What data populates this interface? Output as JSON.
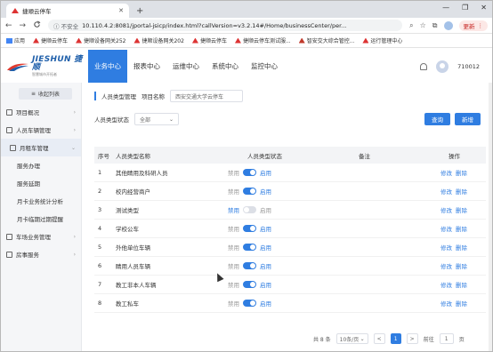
{
  "browser": {
    "tab_title": "捷顺云停车",
    "new_tab": "+",
    "window_controls": {
      "minimize": "—",
      "restore": "❐",
      "close": "✕"
    },
    "nav": {
      "back": "←",
      "forward": "→",
      "reload": "C"
    },
    "insecure_label": "ⓘ 不安全",
    "url": "10.110.4.2:8081/jportal-jsicp/index.html?callVersion=v3.2.14#/Home/businessCenter/per...",
    "update_label": "更新",
    "bookmarks": [
      "应用",
      "捷顺云停车",
      "捷顺设备网关252",
      "捷顺设备网关202",
      "捷顺云停车",
      "捷顺云停车测试服...",
      "智安交大综合管控...",
      "运行管理中心"
    ]
  },
  "app": {
    "logo_brand": "JIESHUN 捷顺",
    "logo_sub": "智慧城市开拓者",
    "nav": [
      "业务中心",
      "报表中心",
      "运维中心",
      "系统中心",
      "监控中心"
    ],
    "active_nav": "业务中心",
    "user": "710012"
  },
  "sidebar": {
    "collapse_label": "收起列表",
    "items": [
      {
        "label": "项目概况",
        "type": "group"
      },
      {
        "label": "人员车辆管理",
        "type": "group"
      },
      {
        "label": "月租车管理",
        "type": "sub"
      },
      {
        "label": "服务办理",
        "type": "leaf"
      },
      {
        "label": "服务延期",
        "type": "leaf"
      },
      {
        "label": "月卡业务统计分析",
        "type": "leaf"
      },
      {
        "label": "月卡临期过期提醒",
        "type": "leaf"
      },
      {
        "label": "车场业务管理",
        "type": "group"
      },
      {
        "label": "房事服务",
        "type": "group"
      }
    ]
  },
  "main": {
    "breadcrumb": "人员类型管理",
    "project_label": "项目名称",
    "project_value": "西安交通大学云停车",
    "filter_label": "人员类型状态",
    "filter_value": "全部",
    "query_button": "查询",
    "add_button": "新增",
    "columns": [
      "序号",
      "人员类型名称",
      "人员类型状态",
      "备注",
      "操作"
    ],
    "rows": [
      {
        "seq": "1",
        "name": "其他睛用及科研人员",
        "state_left": "禁用",
        "state_right": "启用",
        "enabled": true,
        "note": "",
        "edit": "修改",
        "del": "删除"
      },
      {
        "seq": "2",
        "name": "校内经营商户",
        "state_left": "禁用",
        "state_right": "启用",
        "enabled": true,
        "note": "",
        "edit": "修改",
        "del": "删除"
      },
      {
        "seq": "3",
        "name": "测试类型",
        "state_left": "禁用",
        "state_right": "启用",
        "enabled": false,
        "note": "",
        "edit": "修改",
        "del": "删除"
      },
      {
        "seq": "4",
        "name": "学校公车",
        "state_left": "禁用",
        "state_right": "启用",
        "enabled": true,
        "note": "",
        "edit": "修改",
        "del": "删除"
      },
      {
        "seq": "5",
        "name": "外他单位车辆",
        "state_left": "禁用",
        "state_right": "启用",
        "enabled": true,
        "note": "",
        "edit": "修改",
        "del": "删除"
      },
      {
        "seq": "6",
        "name": "睛用人员车辆",
        "state_left": "禁用",
        "state_right": "启用",
        "enabled": true,
        "note": "",
        "edit": "修改",
        "del": "删除"
      },
      {
        "seq": "7",
        "name": "教工非本人车辆",
        "state_left": "禁用",
        "state_right": "启用",
        "enabled": true,
        "note": "",
        "edit": "修改",
        "del": "删除"
      },
      {
        "seq": "8",
        "name": "教工私车",
        "state_left": "禁用",
        "state_right": "启用",
        "enabled": true,
        "note": "",
        "edit": "修改",
        "del": "删除"
      }
    ],
    "pager": {
      "total": "共 8 条",
      "page_size": "10条/页",
      "prev": "<",
      "current": "1",
      "next": ">",
      "goto_label": "前往",
      "goto_value": "1",
      "page_unit": "页"
    }
  },
  "colors": {
    "accent": "#2f7de1",
    "brand": "#1f5faa"
  }
}
